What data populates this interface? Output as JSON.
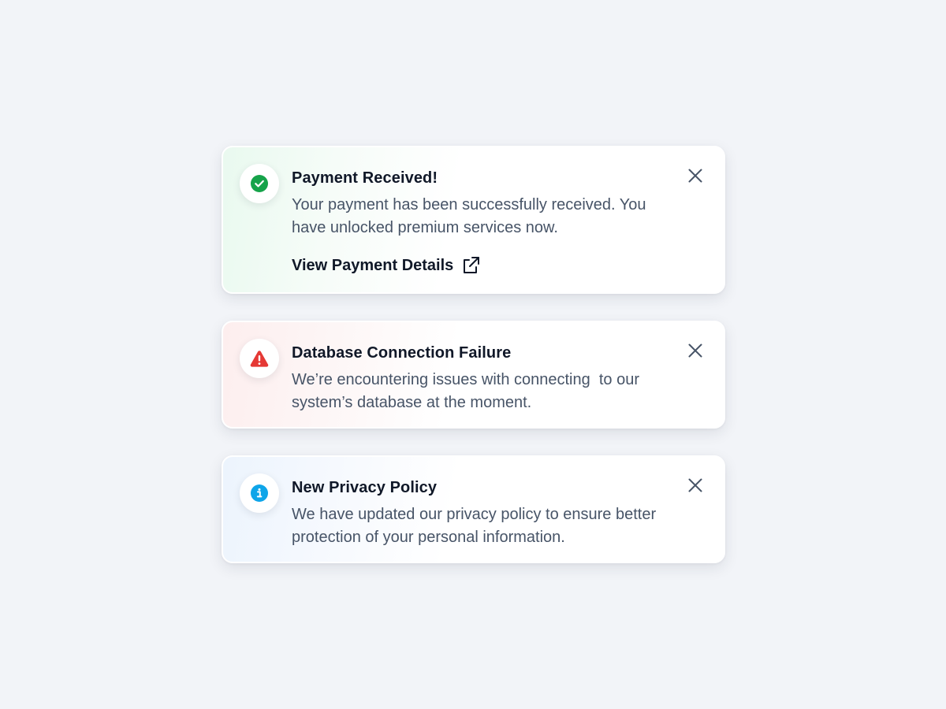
{
  "notifications": [
    {
      "type": "success",
      "icon": "check-circle-icon",
      "accent": "#16a34a",
      "title": "Payment Received!",
      "message": "Your payment has been successfully received. You have unlocked premium services now.",
      "action_label": "View Payment Details",
      "action_icon": "external-link-icon",
      "close_icon": "close-icon"
    },
    {
      "type": "error",
      "icon": "warning-triangle-icon",
      "accent": "#e53935",
      "title": "Database Connection Failure",
      "message": "We’re encountering issues with connecting  to our system’s database at the moment.",
      "close_icon": "close-icon"
    },
    {
      "type": "info",
      "icon": "info-circle-icon",
      "accent": "#0ea5e9",
      "title": "New Privacy Policy",
      "message": "We have updated our privacy policy to ensure better protection of your personal information.",
      "close_icon": "close-icon"
    }
  ]
}
